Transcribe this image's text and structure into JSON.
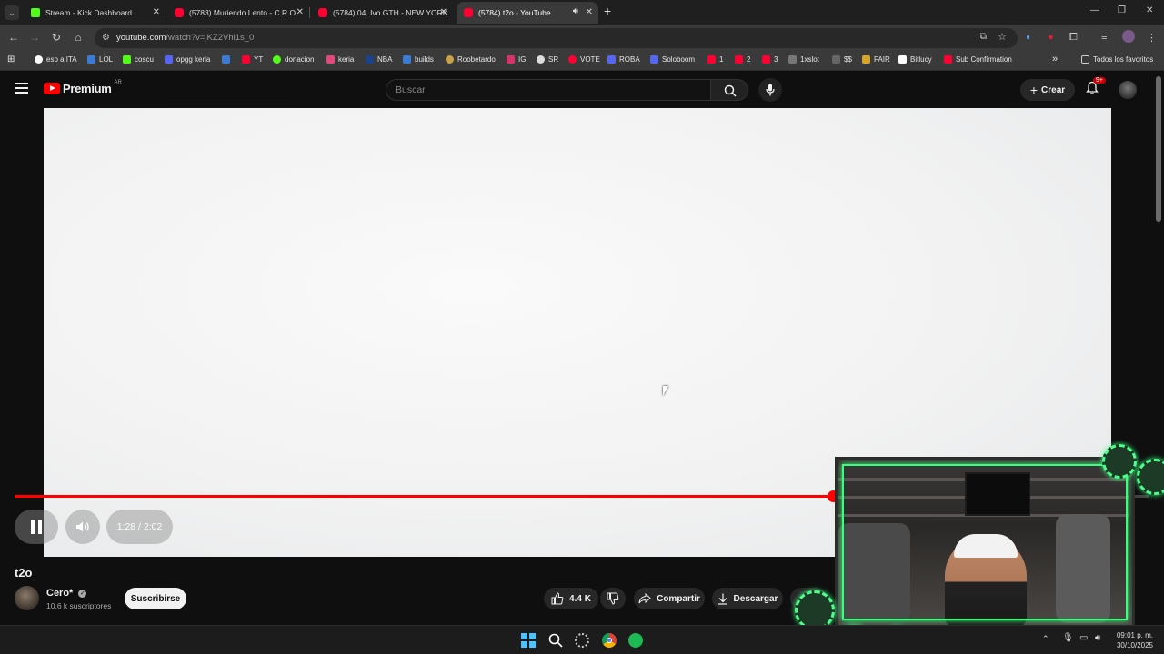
{
  "browser": {
    "tabs": [
      {
        "label": "Stream - Kick Dashboard",
        "color": "#53fc18"
      },
      {
        "label": "(5783) Muriendo Lento - C.R.O",
        "color": "#ff0033"
      },
      {
        "label": "(5784) 04. Ivo GTH - NEW YORK",
        "color": "#ff0033"
      },
      {
        "label": "(5784) t2o - YouTube",
        "color": "#ff0033",
        "active": true
      }
    ],
    "url_host": "youtube.com",
    "url_path": "/watch?v=jKZ2Vhl1s_0",
    "bookmarks": [
      "esp a ITA",
      "LOL",
      "coscu",
      "opgg keria",
      "YT",
      "donacion",
      "keria",
      "NBA",
      "builds",
      "Roobetardo",
      "IG",
      "SR",
      "VOTE",
      "ROBA",
      "Soloboom",
      "1",
      "2",
      "3",
      "1xslot",
      "$$",
      "FAIR",
      "Bitlucy",
      "Sub Confirmation"
    ],
    "all_favorites": "Todos los favoritos"
  },
  "youtube": {
    "logo_text": "Premium",
    "logo_region": "AR",
    "search_placeholder": "Buscar",
    "create_label": "Crear",
    "notif_badge": "9+"
  },
  "player": {
    "time_display": "1:28 / 2:02",
    "progress_fraction": 0.7213
  },
  "video": {
    "title": "t2o",
    "channel": "Cero*",
    "subscribers": "10.6 k suscriptores",
    "subscribe_label": "Suscribirse",
    "likes": "4.4 K",
    "share_label": "Compartir",
    "download_label": "Descargar"
  },
  "taskbar": {
    "time": "09:01 p. m.",
    "date": "30/10/2025"
  },
  "colors": {
    "yt_red": "#ff0000",
    "accent_green": "#39ff7a"
  }
}
